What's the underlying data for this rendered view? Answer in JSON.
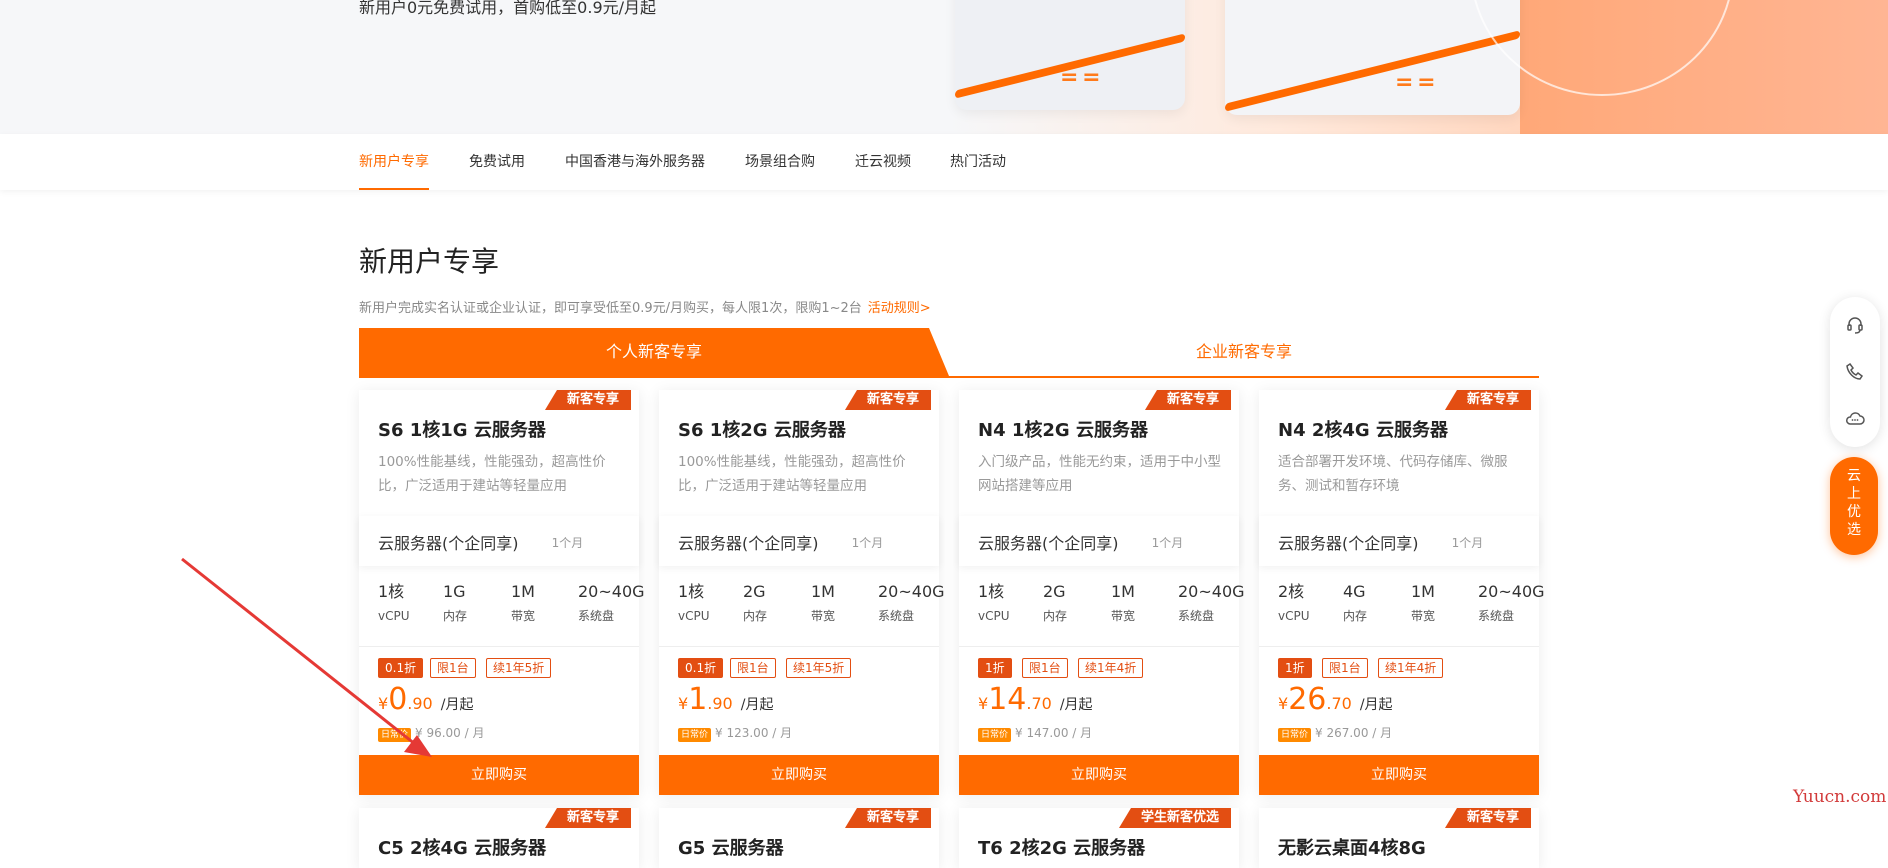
{
  "hero": {
    "subtitle": "新用户0元免费试用，首购低至0.9元/月起"
  },
  "nav": {
    "items": [
      {
        "label": "新用户专享",
        "active": true
      },
      {
        "label": "免费试用"
      },
      {
        "label": "中国香港与海外服务器"
      },
      {
        "label": "场景组合购"
      },
      {
        "label": "迁云视频"
      },
      {
        "label": "热门活动"
      }
    ]
  },
  "section": {
    "title": "新用户专享",
    "desc": "新用户完成实名认证或企业认证，即可享受低至0.9元/月购买，每人限1次，限购1~2台",
    "rules_link": "活动规则>"
  },
  "tabs": {
    "personal": "个人新客专享",
    "enterprise": "企业新客专享"
  },
  "cards": [
    {
      "badge": "新客专享",
      "title": "S6 1核1G 云服务器",
      "desc": "100%性能基线，性能强劲，超高性价比，广泛适用于建站等轻量应用",
      "plan": "云服务器(个企同享)",
      "duration": "1个月",
      "specs": [
        {
          "v": "1核",
          "l": "vCPU"
        },
        {
          "v": "1G",
          "l": "内存"
        },
        {
          "v": "1M",
          "l": "带宽"
        },
        {
          "v": "20~40G",
          "l": "系统盘"
        }
      ],
      "tags": [
        "0.1折",
        "限1台",
        "续1年5折"
      ],
      "price_sym": "¥",
      "price_int": "0",
      "price_dec": ".90",
      "price_unit": "/月起",
      "orig_badge": "日常价",
      "orig": "¥ 96.00 / 月",
      "buy": "立即购买"
    },
    {
      "badge": "新客专享",
      "title": "S6 1核2G 云服务器",
      "desc": "100%性能基线，性能强劲，超高性价比，广泛适用于建站等轻量应用",
      "plan": "云服务器(个企同享)",
      "duration": "1个月",
      "specs": [
        {
          "v": "1核",
          "l": "vCPU"
        },
        {
          "v": "2G",
          "l": "内存"
        },
        {
          "v": "1M",
          "l": "带宽"
        },
        {
          "v": "20~40G",
          "l": "系统盘"
        }
      ],
      "tags": [
        "0.1折",
        "限1台",
        "续1年5折"
      ],
      "price_sym": "¥",
      "price_int": "1",
      "price_dec": ".90",
      "price_unit": "/月起",
      "orig_badge": "日常价",
      "orig": "¥ 123.00 / 月",
      "buy": "立即购买"
    },
    {
      "badge": "新客专享",
      "title": "N4 1核2G 云服务器",
      "desc": "入门级产品，性能无约束，适用于中小型网站搭建等应用",
      "plan": "云服务器(个企同享)",
      "duration": "1个月",
      "specs": [
        {
          "v": "1核",
          "l": "vCPU"
        },
        {
          "v": "2G",
          "l": "内存"
        },
        {
          "v": "1M",
          "l": "带宽"
        },
        {
          "v": "20~40G",
          "l": "系统盘"
        }
      ],
      "tags": [
        "1折",
        "限1台",
        "续1年4折"
      ],
      "price_sym": "¥",
      "price_int": "14",
      "price_dec": ".70",
      "price_unit": "/月起",
      "orig_badge": "日常价",
      "orig": "¥ 147.00 / 月",
      "buy": "立即购买"
    },
    {
      "badge": "新客专享",
      "title": "N4 2核4G 云服务器",
      "desc": "适合部署开发环境、代码存储库、微服务、测试和暂存环境",
      "plan": "云服务器(个企同享)",
      "duration": "1个月",
      "specs": [
        {
          "v": "2核",
          "l": "vCPU"
        },
        {
          "v": "4G",
          "l": "内存"
        },
        {
          "v": "1M",
          "l": "带宽"
        },
        {
          "v": "20~40G",
          "l": "系统盘"
        }
      ],
      "tags": [
        "1折",
        "限1台",
        "续1年4折"
      ],
      "price_sym": "¥",
      "price_int": "26",
      "price_dec": ".70",
      "price_unit": "/月起",
      "orig_badge": "日常价",
      "orig": "¥ 267.00 / 月",
      "buy": "立即购买"
    }
  ],
  "cards_row2": [
    {
      "badge": "新客专享",
      "title": "C5 2核4G 云服务器"
    },
    {
      "badge": "新客专享",
      "title": "G5 云服务器"
    },
    {
      "badge": "学生新客优选",
      "title": "T6 2核2G 云服务器"
    },
    {
      "badge": "新客专享",
      "title": "无影云桌面4核8G"
    }
  ],
  "float": {
    "icons": [
      "headset-icon",
      "phone-icon",
      "cloud-chat-icon"
    ],
    "cta": [
      "云",
      "上",
      "优",
      "选"
    ]
  },
  "watermark": "Yuucn.com",
  "colors": {
    "accent": "#ff6a00",
    "badge": "#e34e12",
    "annotation_arrow": "#e53935"
  }
}
